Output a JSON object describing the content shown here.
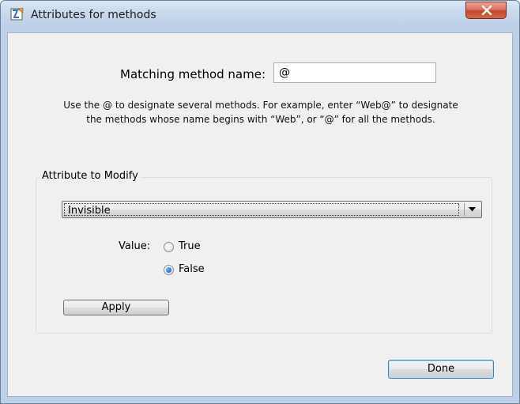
{
  "window": {
    "title": "Attributes for methods",
    "close_icon": "close-x-icon",
    "app_icon": "app-icon"
  },
  "form": {
    "match_label": "Matching method name:",
    "match_value": "@",
    "help_line1": "Use the @ to designate several methods. For example, enter “Web@” to designate",
    "help_line2": "the methods whose name begins with “Web”, or “@” for all the methods."
  },
  "group": {
    "title": "Attribute to Modify",
    "attribute_selected": "Invisible",
    "value_label": "Value:",
    "radio_true": "True",
    "radio_false": "False",
    "selected_value": "False",
    "apply_label": "Apply"
  },
  "footer": {
    "done_label": "Done"
  },
  "colors": {
    "titlebar": "#c9daee",
    "client_bg": "#f0f0f0",
    "close_button": "#c3452c",
    "radio_accent": "#2a7ad6"
  }
}
